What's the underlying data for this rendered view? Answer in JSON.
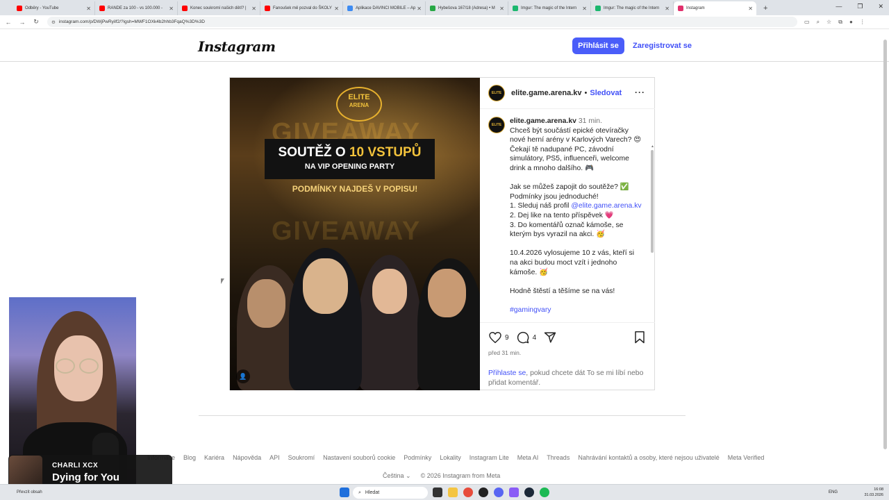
{
  "browser": {
    "tabs": [
      {
        "label": "Odběry - YouTube",
        "color": "#ff0000"
      },
      {
        "label": "RANDE za 100 - vs 100.000 -",
        "color": "#ff0000"
      },
      {
        "label": "Konec soukromí našich dětí? |",
        "color": "#ff0000"
      },
      {
        "label": "Fanoušek mě pozval do ŠKOLY",
        "color": "#ff0000"
      },
      {
        "label": "Aplikace DAVINCI MOBILE – Ap",
        "color": "#3d8bf2"
      },
      {
        "label": "Hybešova 167/18 (Adresa) • M",
        "color": "#27a845"
      },
      {
        "label": "Imgur: The magic of the Intern",
        "color": "#1bb76e"
      },
      {
        "label": "Imgur: The magic of the Intern",
        "color": "#1bb76e"
      },
      {
        "label": "Instagram",
        "color": "#e1306c"
      }
    ],
    "url": "instagram.com/p/DWjPwRyilf2/?igsh=MWF1OXk4b2hhb3FqaQ%3D%3D"
  },
  "header": {
    "logo": "Instagram",
    "login_label": "Přihlásit se",
    "register_label": "Zaregistrovat se"
  },
  "post": {
    "image": {
      "logo_line1": "ELITE",
      "logo_line2": "ARENA",
      "watermark": "GIVEAWAY",
      "banner_prefix": "SOUTĚŽ O ",
      "banner_highlight": "10 VSTUPŮ",
      "banner_sub": "NA VIP OPENING PARTY",
      "subtitle": "PODMÍNKY NAJDEŠ V POPISU!"
    },
    "author": "elite.game.arena.kv",
    "separator": "•",
    "follow_label": "Sledovat",
    "more": "···",
    "avatar_text": "ELITE",
    "caption": {
      "username": "elite.game.arena.kv",
      "time": "31 min.",
      "p1": "Chceš být součástí epické otevíračky nové herní arény v Karlových Varech? 😍 Čekají tě nadupané PC, závodní simulátory, PS5, influenceři, welcome drink a mnoho dalšího. 🎮",
      "p2_a": "Jak se můžeš zapojit do soutěže? ✅",
      "p2_b": "Podmínky jsou jednoduché!",
      "p2_c_prefix": "1. Sleduj náš profil ",
      "p2_c_link": "@elite.game.arena.kv",
      "p2_d": "2.  Dej like na tento příspěvek 💗",
      "p2_e": "3. Do komentářů označ kámoše, se kterým bys vyrazil na akci. 🥳",
      "p3": "10.4.2026 vylosujeme 10 z vás, kteří si na akci budou moct vzít i jednoho kámoše. 🥳",
      "p4": "Hodně štěstí a těšíme se na vás!",
      "hashtag": "#gamingvary"
    },
    "likes": "9",
    "comments": "4",
    "posted_ago": "před 31 min.",
    "login_note_link": "Přihlaste se",
    "login_note_rest": ", pokud chcete dát To se mi líbí nebo přidat komentář."
  },
  "footer": {
    "links": [
      "Informace",
      "Blog",
      "Kariéra",
      "Nápověda",
      "API",
      "Soukromí",
      "Nastavení souborů cookie",
      "Podmínky",
      "Lokality",
      "Instagram Lite",
      "Meta AI",
      "Threads",
      "Nahrávání kontaktů a osoby, které nejsou uživatelé",
      "Meta Verified"
    ],
    "language": "Čeština",
    "copyright": "© 2026 Instagram from Meta"
  },
  "overlay": {
    "artist": "CHARLI XCX",
    "song": "Dying for You"
  },
  "taskbar": {
    "hint": "Převzít obsah",
    "search_placeholder": "Hledat",
    "lang": "ENG",
    "time": "16:08",
    "date": "31.03.2026"
  }
}
